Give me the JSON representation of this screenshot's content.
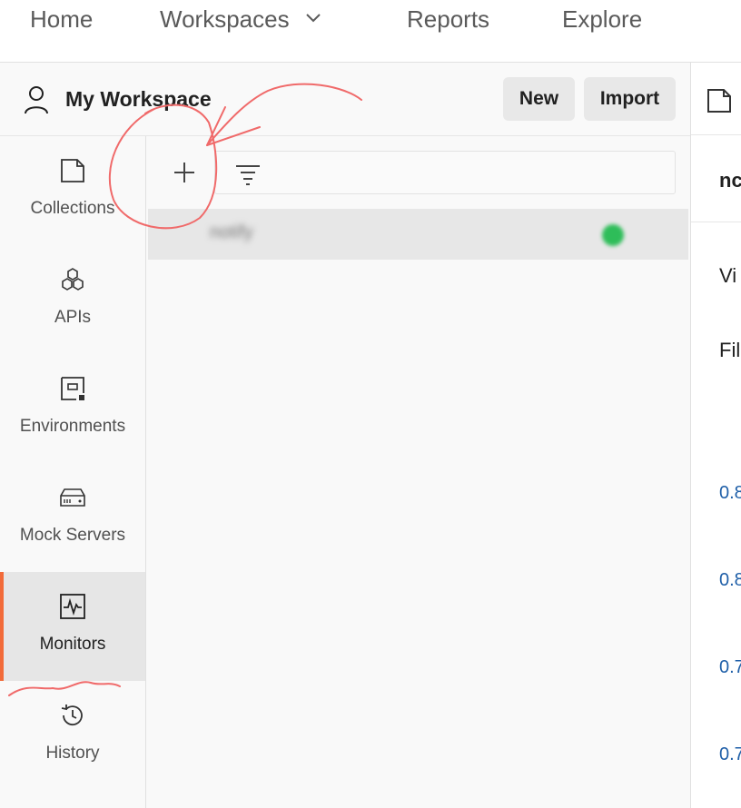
{
  "nav": {
    "items": [
      "Home",
      "Workspaces",
      "Reports",
      "Explore"
    ]
  },
  "workspace": {
    "title": "My Workspace",
    "new_label": "New",
    "import_label": "Import"
  },
  "sidebar": {
    "items": [
      {
        "label": "Collections",
        "icon": "collection-icon"
      },
      {
        "label": "APIs",
        "icon": "apis-icon"
      },
      {
        "label": "Environments",
        "icon": "environment-icon"
      },
      {
        "label": "Mock Servers",
        "icon": "server-icon"
      },
      {
        "label": "Monitors",
        "icon": "monitor-icon",
        "active": true
      },
      {
        "label": "History",
        "icon": "history-icon"
      }
    ]
  },
  "monitors": {
    "items": [
      {
        "name": "notify",
        "status": "healthy",
        "status_color": "#2ebd59"
      }
    ]
  },
  "right_panel": {
    "heading": "nc",
    "line1": "Vi",
    "line2": "Fil",
    "values": [
      "0.8",
      "0.8",
      "0.7",
      "0.7"
    ]
  },
  "colors": {
    "accent": "#f26b3a",
    "link": "#1f5fa8",
    "annotation": "#f06a6a"
  }
}
